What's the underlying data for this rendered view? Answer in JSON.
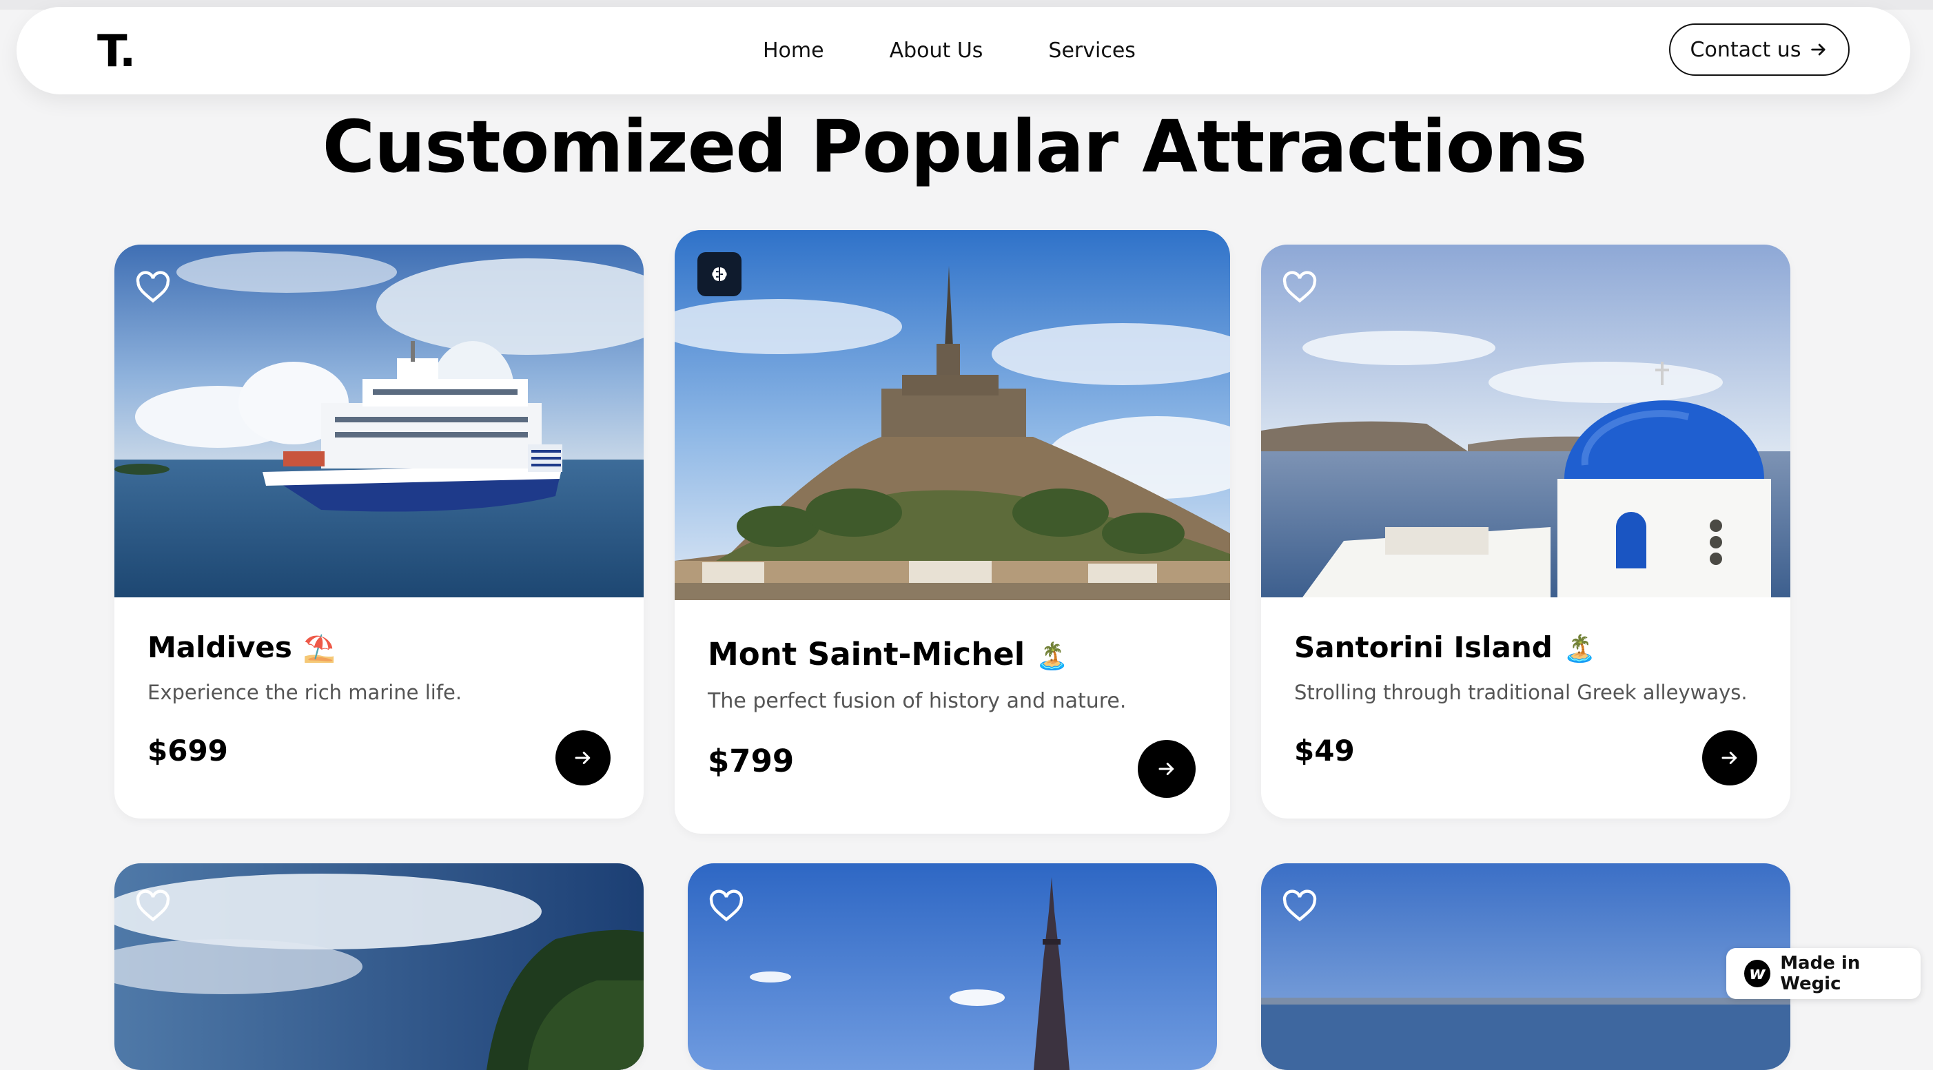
{
  "nav": {
    "logo": "T.",
    "links": [
      "Home",
      "About Us",
      "Services"
    ],
    "contact_label": "Contact us"
  },
  "heading": "Customized Popular Attractions",
  "cards": [
    {
      "title": "Maldives",
      "emoji": "⛱️",
      "description": "Experience the rich marine life.",
      "price": "$699",
      "badge_icon": "heart-icon"
    },
    {
      "title": "Mont Saint-Michel",
      "emoji": "🏝️",
      "description": "The perfect fusion of history and nature.",
      "price": "$799",
      "badge_icon": "brain-icon"
    },
    {
      "title": "Santorini Island",
      "emoji": "🏝️",
      "description": "Strolling through traditional Greek alleyways.",
      "price": "$49",
      "badge_icon": "heart-icon"
    }
  ],
  "colors": {
    "background": "#f4f4f5",
    "accent": "#000000",
    "sky_blue": "#2f72c9",
    "dome_blue": "#1f5fd0"
  },
  "wegic_badge": "Made in Wegic"
}
